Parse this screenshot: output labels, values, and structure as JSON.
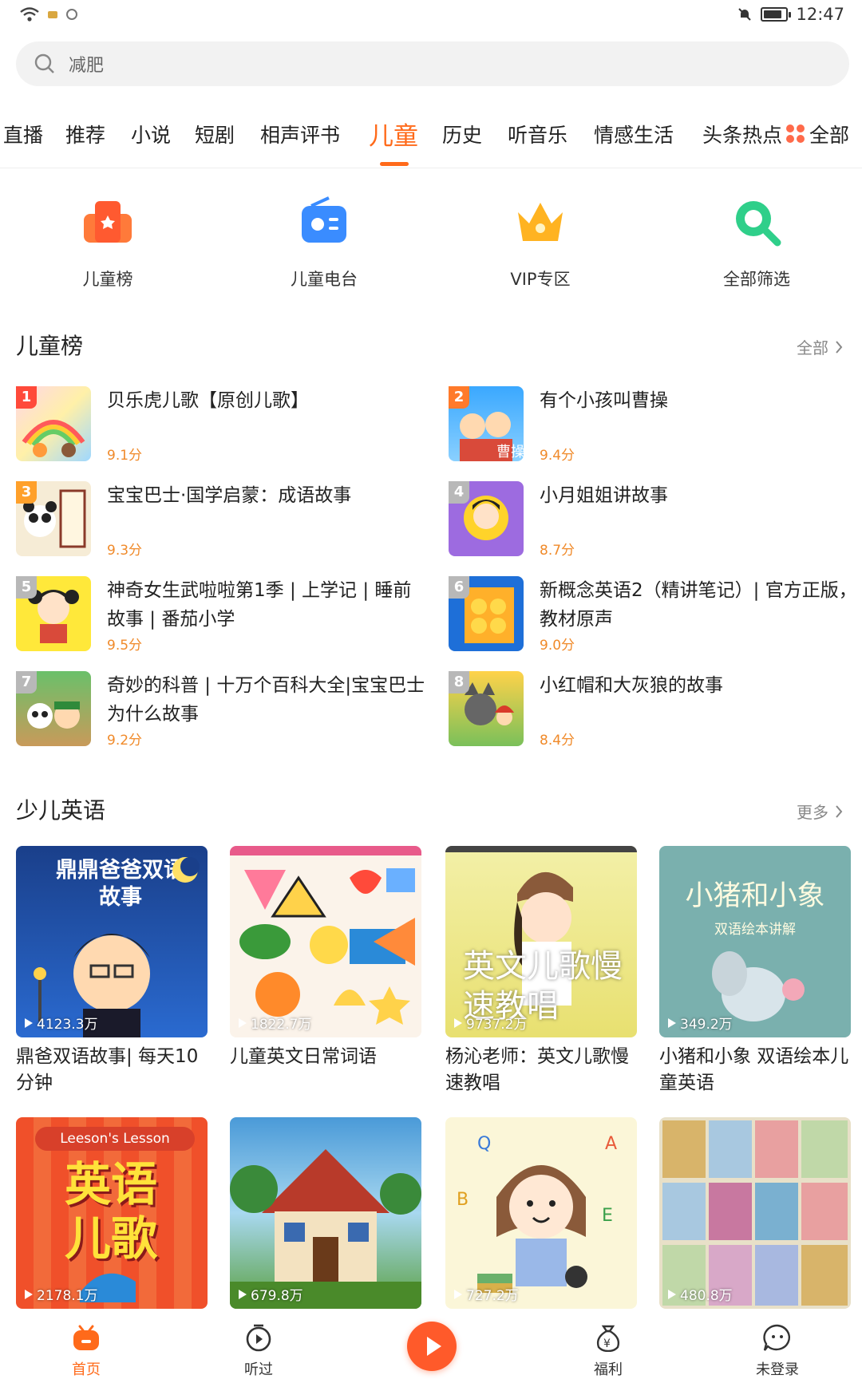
{
  "status": {
    "time": "12:47"
  },
  "search": {
    "placeholder": "减肥"
  },
  "tabs": {
    "items": [
      "直播",
      "推荐",
      "小说",
      "短剧",
      "相声评书",
      "儿童",
      "历史",
      "听音乐",
      "情感生活",
      "头条热点"
    ],
    "active": "儿童",
    "all_label": "全部"
  },
  "quick_links": [
    {
      "label": "儿童榜",
      "icon": "ranking-icon"
    },
    {
      "label": "儿童电台",
      "icon": "radio-icon"
    },
    {
      "label": "VIP专区",
      "icon": "crown-icon"
    },
    {
      "label": "全部筛选",
      "icon": "search-filter-icon"
    }
  ],
  "ranking": {
    "title": "儿童榜",
    "more": "全部",
    "items": [
      {
        "rank": "1",
        "title": "贝乐虎儿歌【原创儿歌】",
        "score": "9.1分"
      },
      {
        "rank": "2",
        "title": "有个小孩叫曹操",
        "score": "9.4分"
      },
      {
        "rank": "3",
        "title": "宝宝巴士·国学启蒙：成语故事",
        "score": "9.3分"
      },
      {
        "rank": "4",
        "title": "小月姐姐讲故事",
        "score": "8.7分"
      },
      {
        "rank": "5",
        "title": "神奇女生武啦啦第1季 | 上学记 | 睡前故事 | 番茄小学",
        "score": "9.5分"
      },
      {
        "rank": "6",
        "title": "新概念英语2（精讲笔记）| 官方正版，教材原声",
        "score": "9.0分"
      },
      {
        "rank": "7",
        "title": "奇妙的科普 | 十万个百科大全|宝宝巴士为什么故事",
        "score": "9.2分"
      },
      {
        "rank": "8",
        "title": "小红帽和大灰狼的故事",
        "score": "8.4分"
      }
    ]
  },
  "english": {
    "title": "少儿英语",
    "more": "更多",
    "cards": [
      {
        "title": "鼎爸双语故事| 每天10分钟",
        "plays": "4123.3万",
        "cover_text": "鼎鼎爸爸双语故事"
      },
      {
        "title": "儿童英文日常词语",
        "plays": "1822.7万",
        "cover_text": ""
      },
      {
        "title": "杨沁老师：英文儿歌慢速教唱",
        "plays": "9737.2万",
        "cover_text": "英文儿歌慢速教唱"
      },
      {
        "title": "小猪和小象 双语绘本儿童英语",
        "plays": "349.2万",
        "cover_text": "小猪和小象",
        "cover_sub": "双语绘本讲解"
      },
      {
        "title": "",
        "plays": "2178.1万",
        "cover_text": "英语儿歌",
        "cover_sub": "Leeson's Lesson"
      },
      {
        "title": "",
        "plays": "679.8万",
        "cover_text": ""
      },
      {
        "title": "",
        "plays": "727.2万",
        "cover_text": ""
      },
      {
        "title": "",
        "plays": "480.8万",
        "cover_text": ""
      }
    ]
  },
  "bottom_nav": [
    {
      "label": "首页",
      "icon": "home-icon",
      "active": true
    },
    {
      "label": "听过",
      "icon": "history-icon",
      "active": false
    },
    {
      "label": "",
      "icon": "play-icon",
      "active": false
    },
    {
      "label": "福利",
      "icon": "money-bag-icon",
      "active": false
    },
    {
      "label": "未登录",
      "icon": "chat-face-icon",
      "active": false
    }
  ],
  "colors": {
    "accent": "#ff6a1a",
    "score": "#f08a2a"
  }
}
